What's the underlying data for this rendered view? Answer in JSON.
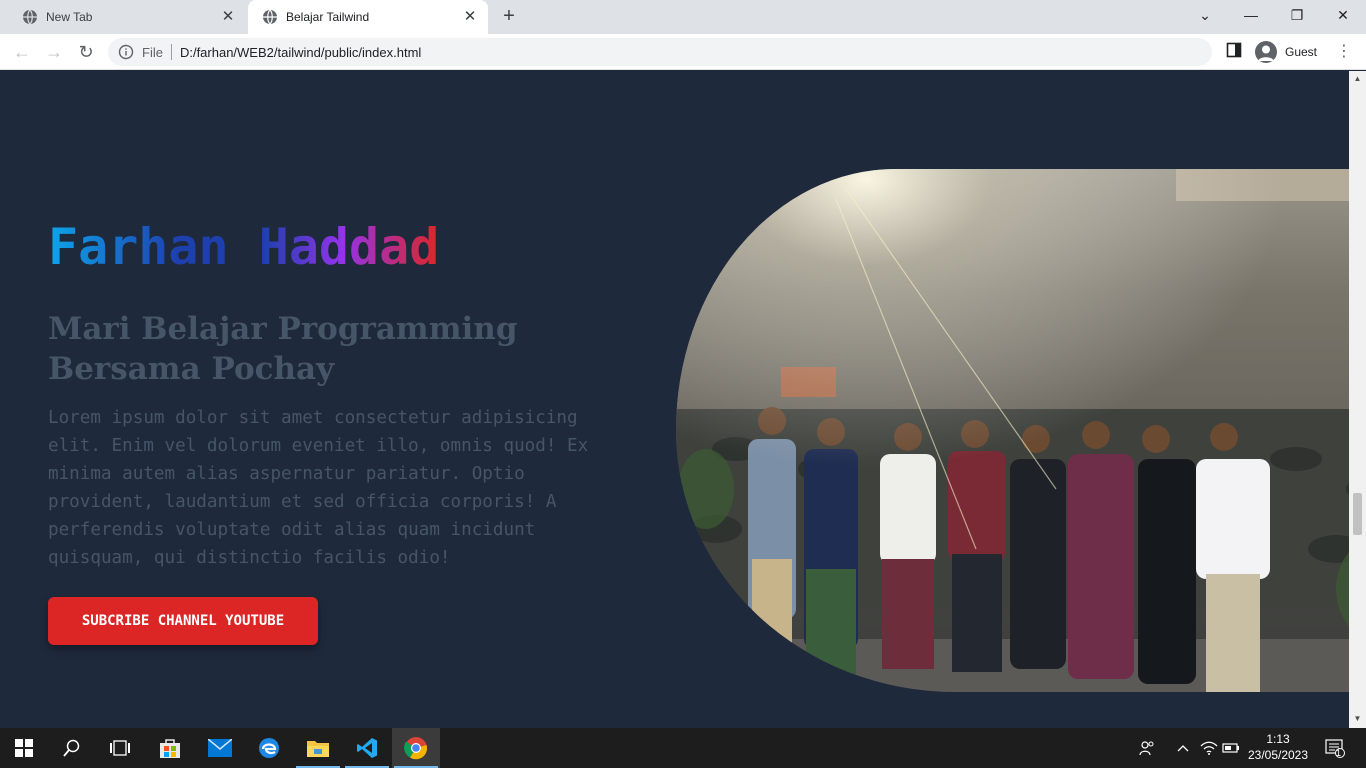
{
  "browser": {
    "tabs": [
      {
        "title": "New Tab",
        "active": false
      },
      {
        "title": "Belajar Tailwind",
        "active": true
      }
    ],
    "address": {
      "scheme_label": "File",
      "url": "D:/farhan/WEB2/tailwind/public/index.html"
    },
    "profile_label": "Guest"
  },
  "hero": {
    "title": "Farhan Haddad",
    "subtitle": "Mari Belajar Programming Bersama Pochay",
    "paragraph": "Lorem ipsum dolor sit amet consectetur adipisicing elit. Enim vel dolorum eveniet illo, omnis quod! Ex minima autem alias aspernatur pariatur. Optio provident, laudantium et sed officia corporis! A perferendis voluptate odit alias quam incidunt quisquam, qui distinctio facilis odio!",
    "cta_label": "SUBCRIBE CHANNEL YOUTUBE",
    "title_gradient": [
      "#0ea5e9",
      "#1e40af",
      "#9333ea",
      "#dc2626"
    ],
    "cta_color": "#dc2626",
    "background_color": "#1e293b"
  },
  "taskbar": {
    "time": "1:13",
    "date": "23/05/2023",
    "notification_count": "1",
    "apps": [
      "windows-start",
      "search",
      "task-view",
      "microsoft-store",
      "mail",
      "edge",
      "file-explorer",
      "vscode",
      "chrome"
    ]
  }
}
